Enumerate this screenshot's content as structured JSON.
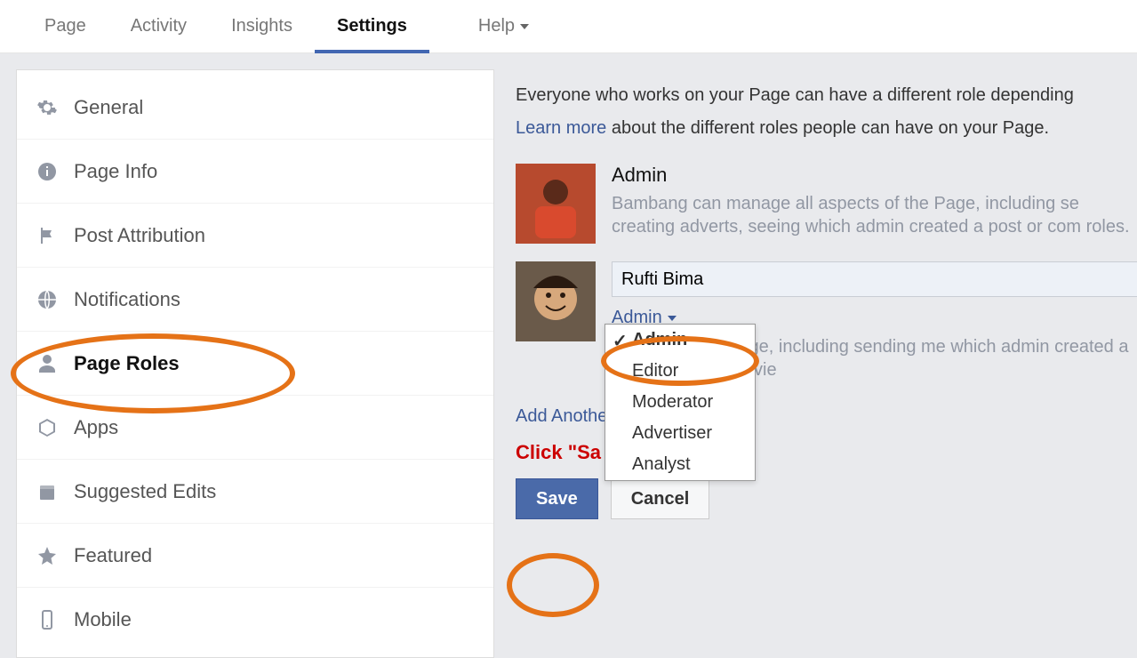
{
  "topnav": {
    "page": "Page",
    "activity": "Activity",
    "insights": "Insights",
    "settings": "Settings",
    "help": "Help"
  },
  "sidebar": {
    "items": [
      {
        "label": "General"
      },
      {
        "label": "Page Info"
      },
      {
        "label": "Post Attribution"
      },
      {
        "label": "Notifications"
      },
      {
        "label": "Page Roles"
      },
      {
        "label": "Apps"
      },
      {
        "label": "Suggested Edits"
      },
      {
        "label": "Featured"
      },
      {
        "label": "Mobile"
      }
    ]
  },
  "main": {
    "intro": "Everyone who works on your Page can have a different role depending",
    "learn": "Learn more",
    "learn_rest": "about the different roles people can have on your Page.",
    "existing": {
      "role": "Admin",
      "desc": "Bambang can manage all aspects of the Page, including se creating adverts, seeing which admin created a post or com roles."
    },
    "new": {
      "name": "Rufti Bima",
      "role_selected": "Admin",
      "behind": "aspects of the Page, including sending me which admin created a post or comment, vie",
      "dropdown": [
        "Admin",
        "Editor",
        "Moderator",
        "Advertiser",
        "Analyst"
      ]
    },
    "add_another": "Add Another",
    "click_note": "Click \"Sa                          our changes",
    "save": "Save",
    "cancel": "Cancel"
  }
}
